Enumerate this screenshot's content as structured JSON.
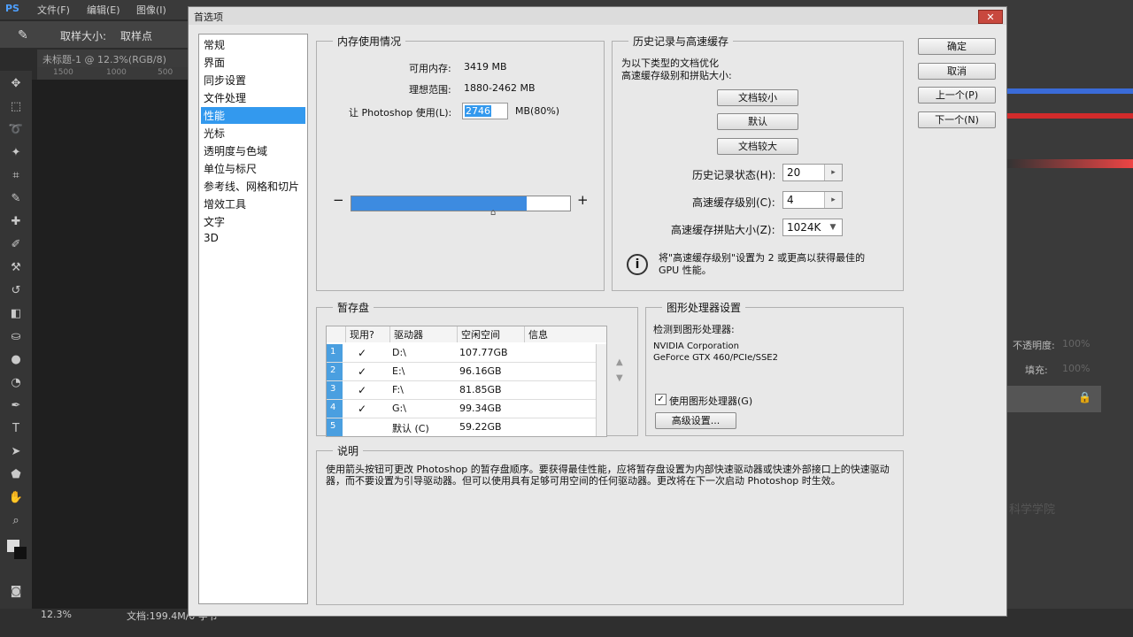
{
  "ps": {
    "logo": "PS",
    "menu": [
      "文件(F)",
      "编辑(E)",
      "图像(I)"
    ],
    "options": {
      "sample_size_label": "取样大小:",
      "sample_size_value": "取样点"
    },
    "doc_tab": "未标题-1 @ 12.3%(RGB/8)",
    "ruler": [
      "1500",
      "1000",
      "500"
    ],
    "status": {
      "zoom": "12.3%",
      "doc": "文档:199.4M/0 字节"
    },
    "right_panel": {
      "opacity_label": "不透明度:",
      "opacity_value": "100%",
      "fill_label": "填充:",
      "fill_value": "100%",
      "watermark": "科学学院"
    }
  },
  "dialog": {
    "title": "首选项",
    "close": "✕",
    "nav": [
      "常规",
      "界面",
      "同步设置",
      "文件处理",
      "性能",
      "光标",
      "透明度与色域",
      "单位与标尺",
      "参考线、网格和切片",
      "增效工具",
      "文字",
      "3D"
    ],
    "nav_selected_index": 4,
    "buttons": {
      "ok": "确定",
      "cancel": "取消",
      "prev": "上一个(P)",
      "next": "下一个(N)"
    },
    "memory": {
      "legend": "内存使用情况",
      "available_label": "可用内存:",
      "available_value": "3419 MB",
      "ideal_label": "理想范围:",
      "ideal_value": "1880-2462 MB",
      "use_label": "让 Photoshop 使用(L):",
      "use_value": "2746",
      "use_suffix": "MB(80%)",
      "minus": "−",
      "plus": "+",
      "usage_percent": 80
    },
    "history": {
      "legend": "历史记录与高速缓存",
      "optimize_text_1": "为以下类型的文档优化",
      "optimize_text_2": "高速缓存级别和拼贴大小:",
      "btn_small": "文档较小",
      "btn_default": "默认",
      "btn_large": "文档较大",
      "states_label": "历史记录状态(H):",
      "states_value": "20",
      "cache_label": "高速缓存级别(C):",
      "cache_value": "4",
      "tile_label": "高速缓存拼贴大小(Z):",
      "tile_value": "1024K",
      "info_text_1": "将\"高速缓存级别\"设置为 2 或更高以获得最佳的",
      "info_text_2": "GPU 性能。",
      "info_icon": "i"
    },
    "scratch": {
      "legend": "暂存盘",
      "headers": [
        "现用?",
        "驱动器",
        "空闲空间",
        "信息"
      ],
      "rows": [
        {
          "num": "1",
          "checked": "✓",
          "drive": "D:\\",
          "space": "107.77GB"
        },
        {
          "num": "2",
          "checked": "✓",
          "drive": "E:\\",
          "space": "96.16GB"
        },
        {
          "num": "3",
          "checked": "✓",
          "drive": "F:\\",
          "space": "81.85GB"
        },
        {
          "num": "4",
          "checked": "✓",
          "drive": "G:\\",
          "space": "99.34GB"
        },
        {
          "num": "5",
          "checked": "",
          "drive": "默认 (C)",
          "space": "59.22GB"
        }
      ],
      "up_arrow": "▲",
      "down_arrow": "▼"
    },
    "gpu": {
      "legend": "图形处理器设置",
      "detected_label": "检测到图形处理器:",
      "vendor": "NVIDIA Corporation",
      "model": "GeForce GTX 460/PCIe/SSE2",
      "use_gpu_label": "使用图形处理器(G)",
      "use_gpu_checked": "✓",
      "advanced_button": "高级设置..."
    },
    "description": {
      "legend": "说明",
      "text": "使用箭头按钮可更改 Photoshop 的暂存盘顺序。要获得最佳性能，应将暂存盘设置为内部快速驱动器或快速外部接口上的快速驱动器，而不要设置为引导驱动器。但可以使用具有足够可用空间的任何驱动器。更改将在下一次启动 Photoshop 时生效。"
    }
  }
}
